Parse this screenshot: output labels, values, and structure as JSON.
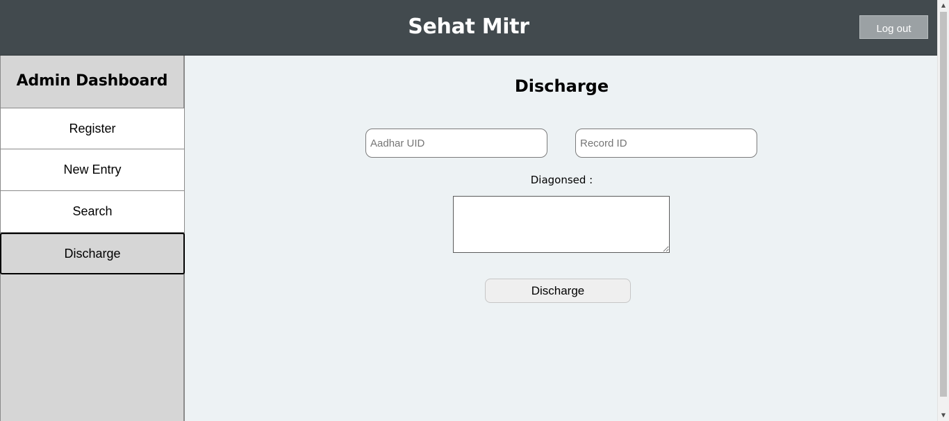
{
  "header": {
    "title": "Sehat Mitr",
    "logout_label": "Log out"
  },
  "sidebar": {
    "title": "Admin Dashboard",
    "items": [
      {
        "label": "Register",
        "active": false
      },
      {
        "label": "New Entry",
        "active": false
      },
      {
        "label": "Search",
        "active": false
      },
      {
        "label": "Discharge",
        "active": true
      }
    ]
  },
  "main": {
    "title": "Discharge",
    "aadhar": {
      "placeholder": "Aadhar UID",
      "value": ""
    },
    "record": {
      "placeholder": "Record ID",
      "value": ""
    },
    "diagnosed_label": "Diagonsed :",
    "diagnosed_value": "",
    "submit_label": "Discharge"
  },
  "icons": {
    "scroll_up": "scroll-up-icon",
    "scroll_down": "scroll-down-icon"
  },
  "colors": {
    "header_bg": "#424a4e",
    "sidebar_bg": "#d6d6d6",
    "main_bg": "#edf2f4",
    "logout_bg": "#9ba1a4"
  }
}
